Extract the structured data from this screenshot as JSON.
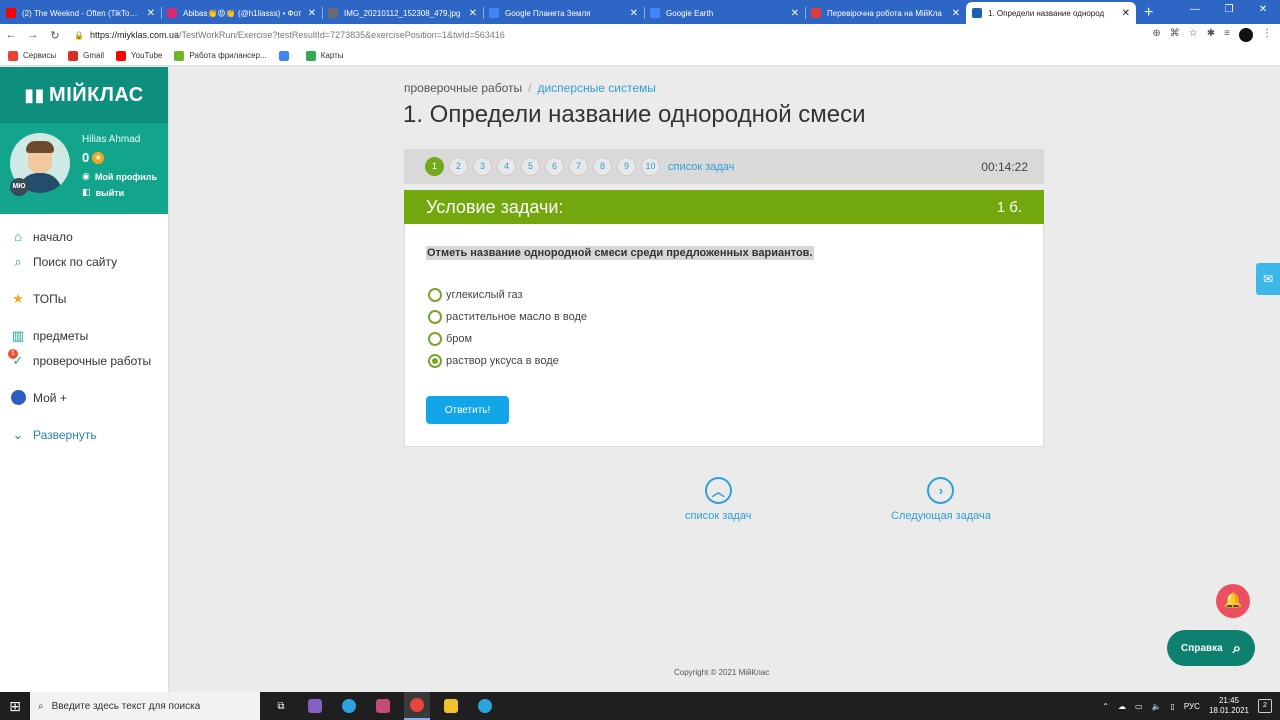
{
  "browser": {
    "tabs": [
      {
        "title": "(2) The Weeknd - Often (TikTok R",
        "color": "#ff0000"
      },
      {
        "title": "Abibas👏😡👏 (@h1liasss) • Фот",
        "color": "#d62976"
      },
      {
        "title": "IMG_20210112_152308_479.jpg",
        "color": "#6b6b6b"
      },
      {
        "title": "Google Планета Земля",
        "color": "#4285f4"
      },
      {
        "title": "Google Earth",
        "color": "#4285f4"
      },
      {
        "title": "Перевірочна робота на МійКла",
        "color": "#e23b3b"
      },
      {
        "title": "1. Определи название однород",
        "color": "#1a5fb4",
        "active": true
      }
    ],
    "close_glyph": "✕",
    "new_tab": "+",
    "window_controls": [
      "—",
      "❐",
      "✕"
    ],
    "url_host": "https://miyklas.com.ua",
    "url_path": "/TestWorkRun/Exercise?testResultId=7273835&exercisePosition=1&twId=563416",
    "bookmarks": [
      {
        "label": "Сервисы",
        "color": "#ea4335"
      },
      {
        "label": "Gmail",
        "color": "#d93025"
      },
      {
        "label": "YouTube",
        "color": "#ff0000"
      },
      {
        "label": "Работа фрилансер...",
        "color": "#6fb82c"
      },
      {
        "label": "",
        "color": "#4285f4"
      },
      {
        "label": "Карты",
        "color": "#34a853"
      }
    ]
  },
  "sidebar": {
    "logo": "МІЙКЛАС",
    "user_name": "Hilias Ahmad",
    "points": "0",
    "avatar_badge": "MЮ",
    "my_profile": "Мой профиль",
    "logout": "выйти",
    "items": [
      {
        "label": "начало",
        "icon": "home-icon"
      },
      {
        "label": "Поиск по сайту",
        "icon": "search-icon"
      },
      {
        "label": "ТОПы",
        "icon": "star-icon"
      },
      {
        "label": "предметы",
        "icon": "books-icon"
      },
      {
        "label": "проверочные работы",
        "icon": "check-icon",
        "badge": "1"
      },
      {
        "label": "Мой +",
        "icon": "my-plus-icon"
      },
      {
        "label": "Развернуть",
        "icon": "chevron-down-icon"
      }
    ]
  },
  "main": {
    "breadcrumb_root": "проверочные работы",
    "breadcrumb_current": "дисперсные системы",
    "title": "1. Определи название однородной смеси",
    "task_numbers": [
      "1",
      "2",
      "3",
      "4",
      "5",
      "6",
      "7",
      "8",
      "9",
      "10"
    ],
    "task_list_link": "список задач",
    "timer": "00:14:22",
    "condition_title": "Условие задачи:",
    "condition_points": "1 б.",
    "question": "Отметь  название однородной смеси среди предложенных вариантов.",
    "options": [
      {
        "label": "углекислый газ",
        "checked": false
      },
      {
        "label": "растительное масло в воде",
        "checked": false
      },
      {
        "label": "бром",
        "checked": false
      },
      {
        "label": "раствор уксуса в воде",
        "checked": true
      }
    ],
    "answer_button": "Ответить!",
    "bottom_list": "список задач",
    "bottom_next": "Следующая задача",
    "copyright": "Copyright © 2021 МійКлас",
    "help": "Справка"
  },
  "taskbar": {
    "search_placeholder": "Введите здесь текст для поиска",
    "lang": "РУС",
    "time": "21:45",
    "date": "18.01.2021",
    "notif_count": "2"
  },
  "colors": {
    "brand": "#12a58c",
    "accent_green": "#72a80e",
    "link_blue": "#2e9fd6"
  }
}
